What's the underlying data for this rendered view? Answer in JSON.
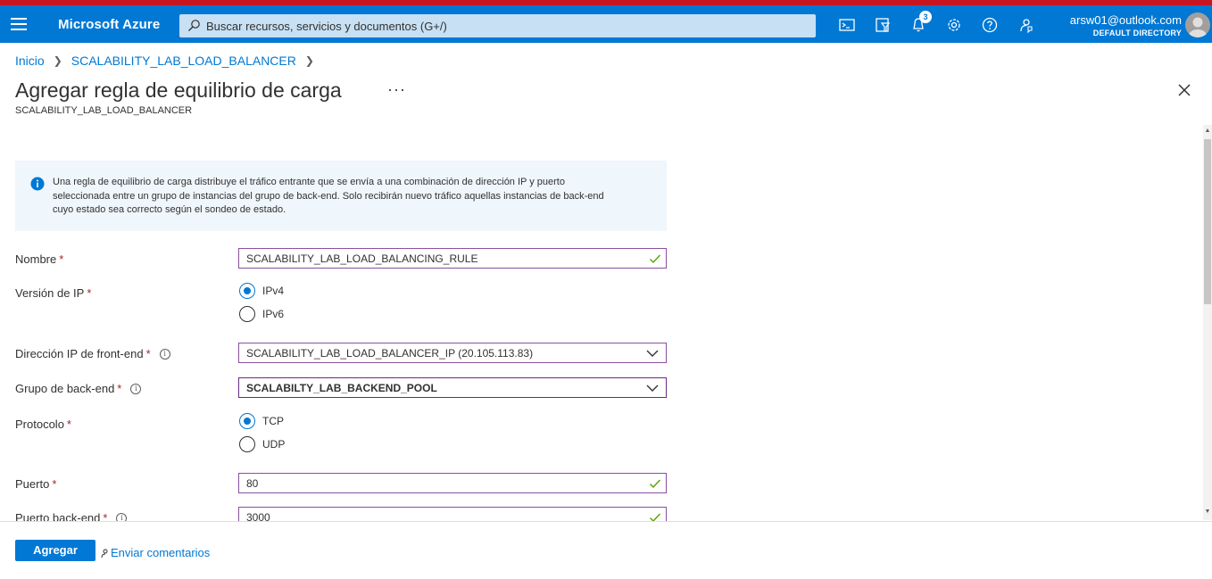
{
  "topbar": {
    "brand": "Microsoft Azure",
    "search_placeholder": "Buscar recursos, servicios y documentos (G+/)",
    "notification_count": "3",
    "account_email": "arsw01@outlook.com",
    "account_directory": "DEFAULT DIRECTORY",
    "icons": [
      "menu-icon",
      "cloud-shell-icon",
      "directory-filter-icon",
      "bell-icon",
      "gear-icon",
      "help-icon",
      "feedback-icon"
    ],
    "accent_color": "#0078d4"
  },
  "breadcrumb": {
    "items": [
      "Inicio",
      "SCALABILITY_LAB_LOAD_BALANCER"
    ]
  },
  "page": {
    "title": "Agregar regla de equilibrio de carga",
    "subtitle": "SCALABILITY_LAB_LOAD_BALANCER",
    "ellipsis": "···"
  },
  "info": {
    "text_line1": "Una regla de equilibrio de carga distribuye el tráfico entrante que se envía a una combinación de dirección IP y puerto",
    "text_line2": "seleccionada entre un grupo de instancias del grupo de back-end. Solo recibirán nuevo tráfico aquellas instancias de back-end",
    "text_line3": "cuyo estado sea correcto según el sondeo de estado."
  },
  "form": {
    "name": {
      "label": "Nombre",
      "value": "SCALABILITY_LAB_LOAD_BALANCING_RULE"
    },
    "ip_version": {
      "label": "Versión de IP",
      "options": [
        "IPv4",
        "IPv6"
      ],
      "selected": "IPv4"
    },
    "frontend_ip": {
      "label": "Dirección IP de front-end",
      "value": "SCALABILITY_LAB_LOAD_BALANCER_IP (20.105.113.83)"
    },
    "backend_pool": {
      "label": "Grupo de back-end",
      "value": "SCALABILTY_LAB_BACKEND_POOL"
    },
    "protocol": {
      "label": "Protocolo",
      "options": [
        "TCP",
        "UDP"
      ],
      "selected": "TCP"
    },
    "port": {
      "label": "Puerto",
      "value": "80"
    },
    "backend_port": {
      "label": "Puerto back-end",
      "value": "3000"
    },
    "required_mark": "*",
    "info_mark": "i"
  },
  "footer": {
    "primary_button": "Agregar",
    "feedback_link": "Enviar comentarios"
  }
}
